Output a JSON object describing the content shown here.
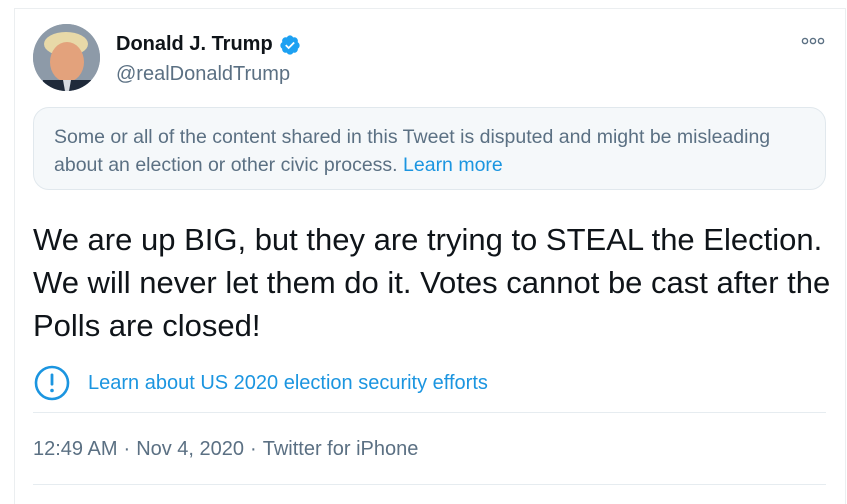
{
  "author": {
    "display_name": "Donald J. Trump",
    "handle": "@realDonaldTrump",
    "verified_icon": "verified-badge-icon"
  },
  "notice": {
    "text": "Some or all of the content shared in this Tweet is disputed and might be misleading about an election or other civic process.",
    "link": "Learn more"
  },
  "tweet": {
    "text": "We are up BIG, but they are trying to STEAL the Election. We will never let them do it. Votes cannot be cast after the Polls are closed!"
  },
  "label": {
    "icon": "exclamation-circle-icon",
    "link": "Learn about US 2020 election security efforts"
  },
  "meta": {
    "time": "12:49 AM",
    "separator": "·",
    "date": "Nov 4, 2020",
    "source": "Twitter for iPhone"
  },
  "colors": {
    "link_blue": "#1b95e0",
    "secondary_text": "#5b7083",
    "primary_text": "#0f1419",
    "verified_blue": "#1da1f2"
  }
}
